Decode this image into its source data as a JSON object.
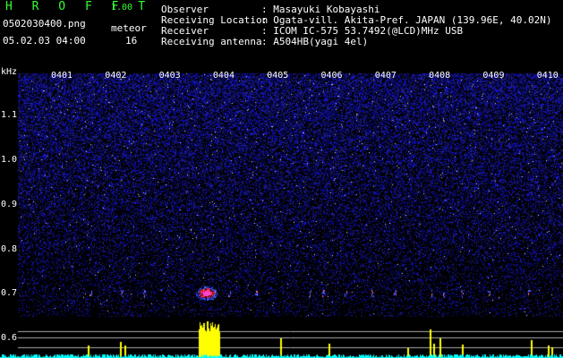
{
  "header": {
    "app_title": "H R O F F T",
    "version": "1.00",
    "filename": "0502030400.png",
    "datetime": "05.02.03 04:00",
    "meteor_label": "meteor",
    "meteor_count": "16"
  },
  "info": [
    {
      "key": "Observer",
      "value": ": Masayuki Kobayashi"
    },
    {
      "key": "Receiving Location",
      "value": ": Ogata-vill. Akita-Pref. JAPAN (139.96E, 40.02N)"
    },
    {
      "key": "Receiver",
      "value": ": ICOM IC-575 53.7492(@LCD)MHz USB"
    },
    {
      "key": "Receiving antenna",
      "value": ": A504HB(yagi 4el)"
    }
  ],
  "spectrogram": {
    "unit_label": "kHz",
    "time_ticks": [
      "0401",
      "0402",
      "0403",
      "0404",
      "0405",
      "0406",
      "0407",
      "0408",
      "0409",
      "0410"
    ],
    "freq_ticks": [
      "1.1",
      "1.0",
      "0.9",
      "0.8",
      "0.7",
      "0.6"
    ],
    "colors": {
      "bg": "#000000",
      "noise": "#1a1aa0",
      "echo": "#ff3344",
      "level": "#ffff00",
      "baseline": "#00ffff"
    }
  }
}
